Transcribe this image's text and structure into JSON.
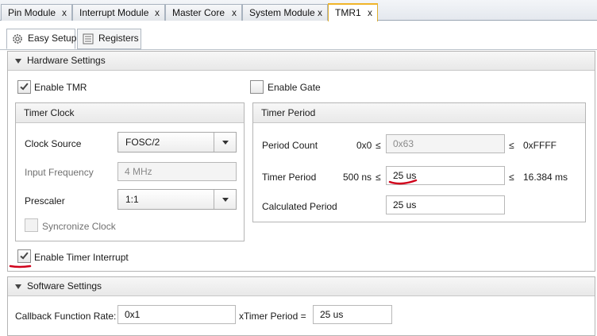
{
  "doc_tabs": [
    {
      "label": "Pin Module",
      "close": "x"
    },
    {
      "label": "Interrupt Module",
      "close": "x"
    },
    {
      "label": "Master Core",
      "close": "x"
    },
    {
      "label": "System Module",
      "close": "x"
    },
    {
      "label": "TMR1",
      "close": "x",
      "active": true
    }
  ],
  "sub_tabs": [
    {
      "label": "Easy Setup",
      "icon": "gear-icon",
      "active": true
    },
    {
      "label": "Registers",
      "icon": "registers-icon"
    }
  ],
  "hardware": {
    "title": "Hardware Settings",
    "enable_tmr": {
      "label": "Enable TMR",
      "checked": true
    },
    "enable_gate": {
      "label": "Enable Gate",
      "checked": false
    },
    "timer_clock": {
      "title": "Timer Clock",
      "clock_source": {
        "label": "Clock Source",
        "value": "FOSC/2"
      },
      "input_frequency": {
        "label": "Input Frequency",
        "value": "4 MHz"
      },
      "prescaler": {
        "label": "Prescaler",
        "value": "1:1"
      },
      "sync_clock": {
        "label": "Syncronize Clock",
        "checked": false
      }
    },
    "timer_period": {
      "title": "Timer Period",
      "period_count": {
        "label": "Period Count",
        "min": "0x0",
        "le1": "≤",
        "value": "0x63",
        "le2": "≤",
        "max": "0xFFFF"
      },
      "timer_period_row": {
        "label": "Timer Period",
        "min": "500 ns",
        "le1": "≤",
        "value": "25 us",
        "le2": "≤",
        "max": "16.384 ms"
      },
      "calculated_period": {
        "label": "Calculated Period",
        "value": "25 us"
      }
    },
    "enable_timer_interrupt": {
      "label": "Enable Timer Interrupt",
      "checked": true
    }
  },
  "software": {
    "title": "Software Settings",
    "callback_rate": {
      "label": "Callback Function Rate:",
      "value": "0x1"
    },
    "xtimer_period": {
      "label": "xTimer Period =",
      "value": "25 us"
    }
  },
  "colors": {
    "annotation": "#d0021b",
    "active_tab_accent": "#f0b429"
  }
}
